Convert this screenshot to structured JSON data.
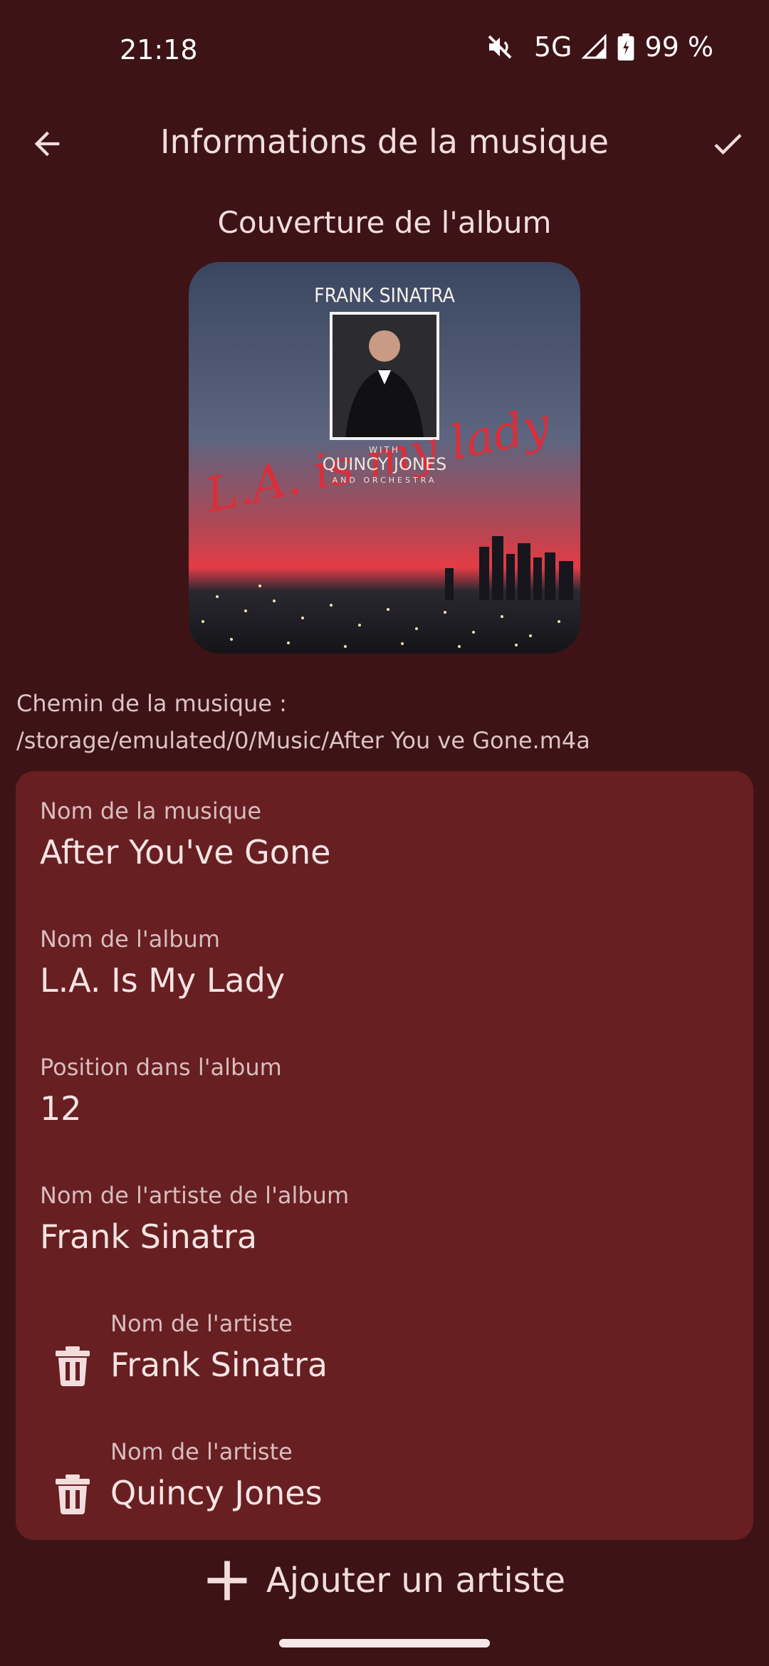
{
  "status": {
    "time": "21:18",
    "network": "5G",
    "battery": "99 %"
  },
  "header": {
    "title": "Informations de la musique",
    "back_icon": "arrow-back-icon",
    "confirm_icon": "check-icon"
  },
  "cover": {
    "label": "Couverture de l'album",
    "art_title": "FRANK SINATRA",
    "art_script": "L.A. is my lady",
    "art_with": "WITH",
    "art_subtitle": "QUINCY JONES",
    "art_orchestra": "AND ORCHESTRA"
  },
  "path": {
    "label": "Chemin de la musique :",
    "value": "/storage/emulated/0/Music/After You ve Gone.m4a"
  },
  "fields": {
    "track_name": {
      "label": "Nom de la musique",
      "value": "After You've Gone"
    },
    "album_name": {
      "label": "Nom de l'album",
      "value": "L.A. Is My Lady"
    },
    "position": {
      "label": "Position dans l'album",
      "value": "12"
    },
    "album_artist": {
      "label": "Nom de l'artiste de l'album",
      "value": "Frank Sinatra"
    }
  },
  "artists": [
    {
      "label": "Nom de l'artiste",
      "value": "Frank Sinatra"
    },
    {
      "label": "Nom de l'artiste",
      "value": "Quincy Jones"
    }
  ],
  "add_artist": {
    "label": "Ajouter un artiste",
    "icon": "plus-icon"
  },
  "colors": {
    "background": "#3d1316",
    "card": "#671f22",
    "text": "#f2dddd"
  }
}
